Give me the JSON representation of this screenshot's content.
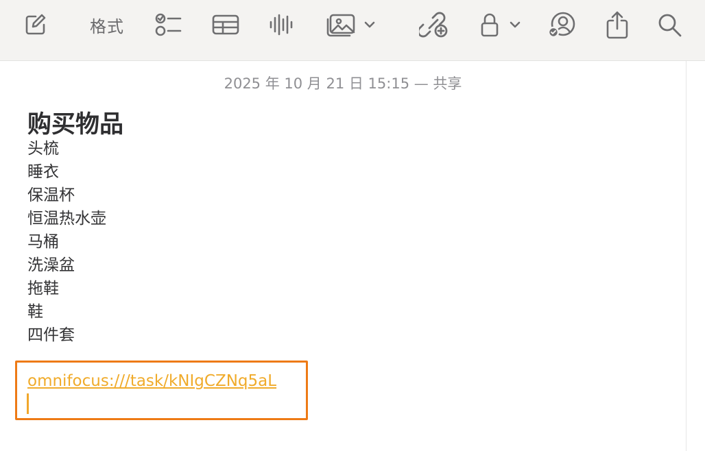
{
  "toolbar": {
    "items": [
      {
        "name": "compose-icon"
      },
      {
        "name": "format-button",
        "label": "格式"
      },
      {
        "name": "checklist-icon"
      },
      {
        "name": "table-icon"
      },
      {
        "name": "audio-waveform-icon"
      },
      {
        "name": "media-icon"
      },
      {
        "name": "collaborate-link-icon"
      },
      {
        "name": "lock-icon"
      },
      {
        "name": "shared-user-icon"
      },
      {
        "name": "share-icon"
      },
      {
        "name": "search-icon"
      }
    ],
    "format_label": "格式"
  },
  "note": {
    "date": "2025 年 10 月 21 日 15:15 — 共享",
    "title": "购买物品",
    "items": [
      "头梳",
      "睡衣",
      "保温杯",
      "恒温热水壶",
      "马桶",
      "洗澡盆",
      "拖鞋",
      "鞋",
      "四件套"
    ],
    "link": "omnifocus:///task/kNIgCZNq5aL"
  },
  "colors": {
    "accent": "#f0ab2b",
    "highlight_border": "#ee7a15",
    "toolbar_bg": "#f4f3f1"
  }
}
